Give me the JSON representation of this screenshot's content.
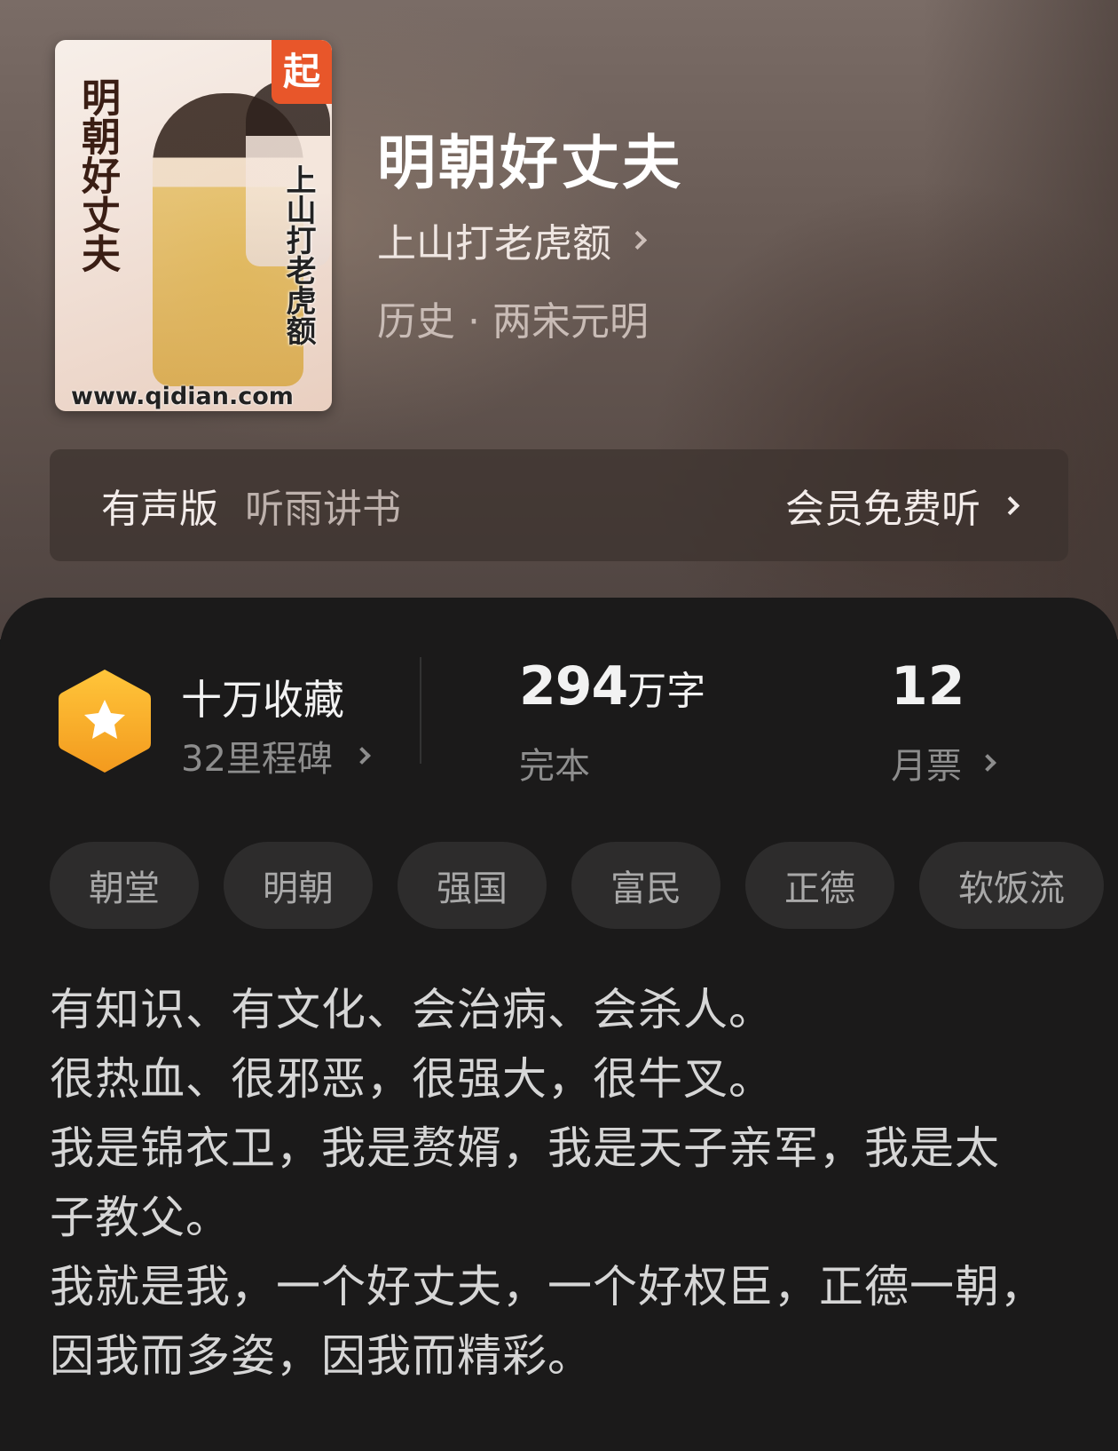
{
  "book": {
    "cover_title": "明朝好丈夫",
    "cover_author": "上山打老虎额",
    "cover_badge": "起",
    "cover_url": "www.qidian.com",
    "title": "明朝好丈夫",
    "author": "上山打老虎额",
    "genre": "历史 · 两宋元明"
  },
  "audio": {
    "label": "有声版",
    "narrator": "听雨讲书",
    "cta": "会员免费听"
  },
  "stats": {
    "favorites": "十万收藏",
    "milestones": "32里程碑",
    "word_count": "294",
    "word_unit": "万字",
    "status": "完本",
    "monthly_tickets": "12",
    "tickets_label": "月票"
  },
  "tags": [
    "朝堂",
    "明朝",
    "强国",
    "富民",
    "正德",
    "软饭流"
  ],
  "description": [
    "有知识、有文化、会治病、会杀人。",
    "很热血、很邪恶，很强大，很牛叉。",
    "我是锦衣卫，我是赘婿，我是天子亲军，我是太",
    "子教父。",
    "我就是我，一个好丈夫，一个好权臣，正德一朝，",
    "因我而多姿，因我而精彩。"
  ],
  "colors": {
    "accent": "#f5a623",
    "sheet_bg": "#1b1a1a",
    "tag_bg": "#2d2c2c"
  },
  "icons": {
    "favorites": "star-hexagon-icon",
    "chevron": "chevron-right-icon"
  }
}
